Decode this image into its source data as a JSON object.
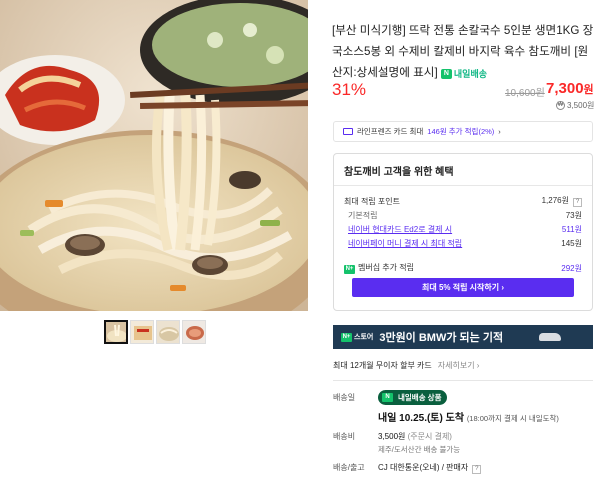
{
  "product": {
    "title": "[부산 미식기행] 뜨락 전통 손칼국수 5인분 생면1KG 장국소스5봉 외 수제비 칼제비 바지락 육수 참도깨비 [원산지:상세설명에 표시]",
    "today_delivery_badge": "내일배송",
    "discount_rate": "31%",
    "original_price": "10,600원",
    "sale_price_number": "7,300",
    "sale_price_unit": "원",
    "points": "3,500원"
  },
  "card_promo": {
    "text_prefix": "라인프렌즈 카드 최대",
    "highlight": "146원 추가 적립(2%)",
    "arrow": "›"
  },
  "benefits": {
    "heading": "참도깨비 고객을 위한 혜택",
    "max_points_label": "최대 적립 포인트",
    "max_points_value": "1,276원",
    "basic_label": "기본적립",
    "basic_value": "73원",
    "hyundai_label": "네이버 현대카드 Ed2로 결제 시",
    "hyundai_value": "511원",
    "npay_label": "네이버페이 머니 결제 시 최대 적립",
    "npay_value": "145원",
    "membership_label": "멤버십 추가 적립",
    "membership_value": "292원",
    "membership_button": "최대 5% 적립 시작하기 ›"
  },
  "bmw_banner": {
    "store_label": "스토어",
    "headline": "3만원이 BMW가 되는 기적"
  },
  "installment": {
    "text": "최대 12개월 무이자 할부 카드",
    "link": "자세히보기 ›"
  },
  "shipping": {
    "label_delivery": "배송일",
    "badge": "내일배송 상품",
    "date": "내일 10.25.(토) 도착",
    "date_note": "(18:00까지 결제 시 내일도착)",
    "label_fee": "배송비",
    "fee": "3,500원",
    "fee_note": "(주문시 결제)",
    "island_note": "제주/도서산간 배송 불가능",
    "label_carrier": "배송/출고",
    "carrier": "CJ 대한통운(오네) / 판매자"
  },
  "colors": {
    "accent_purple": "#5a2df0",
    "price_red": "#fa2828",
    "naver_green": "#14c26b",
    "banner_navy": "#1f3a53"
  }
}
